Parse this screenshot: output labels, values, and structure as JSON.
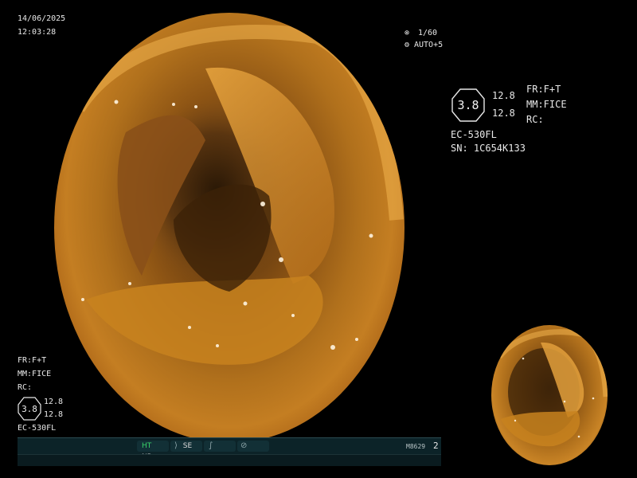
{
  "datetime": {
    "date": "14/06/2025",
    "time": "12:03:28"
  },
  "shutter": {
    "icon": "shutter-icon",
    "speed": "1/60",
    "iris_icon": "iris-icon",
    "exposure": "AUTO+5"
  },
  "settings": {
    "badge_value": "3.8",
    "value_top": "12.8",
    "value_bottom": "12.8",
    "fr": "FR:F+T",
    "mm": "MM:FICE",
    "rc": "RC:",
    "scope_model": "EC-530FL",
    "serial": "SN: 1C654K133"
  },
  "left_panel": {
    "fr": "FR:F+T",
    "mm": "MM:FICE",
    "rc": "RC:",
    "badge_value": "3.8",
    "value_top": "12.8",
    "value_bottom": "12.8",
    "scope_model": "EC-530FL"
  },
  "status_bar": {
    "ht": "HT",
    "nr": "NR",
    "se_icon": "structure-enhance-icon",
    "se": "SE",
    "f_icon": "freeze-icon",
    "mode_icon": "mode-dial-icon",
    "code": "M8629",
    "page": "2"
  },
  "colors": {
    "overlay_text": "#e8e8e8",
    "status_green": "#39d36a",
    "status_bg": "#0c2328"
  }
}
